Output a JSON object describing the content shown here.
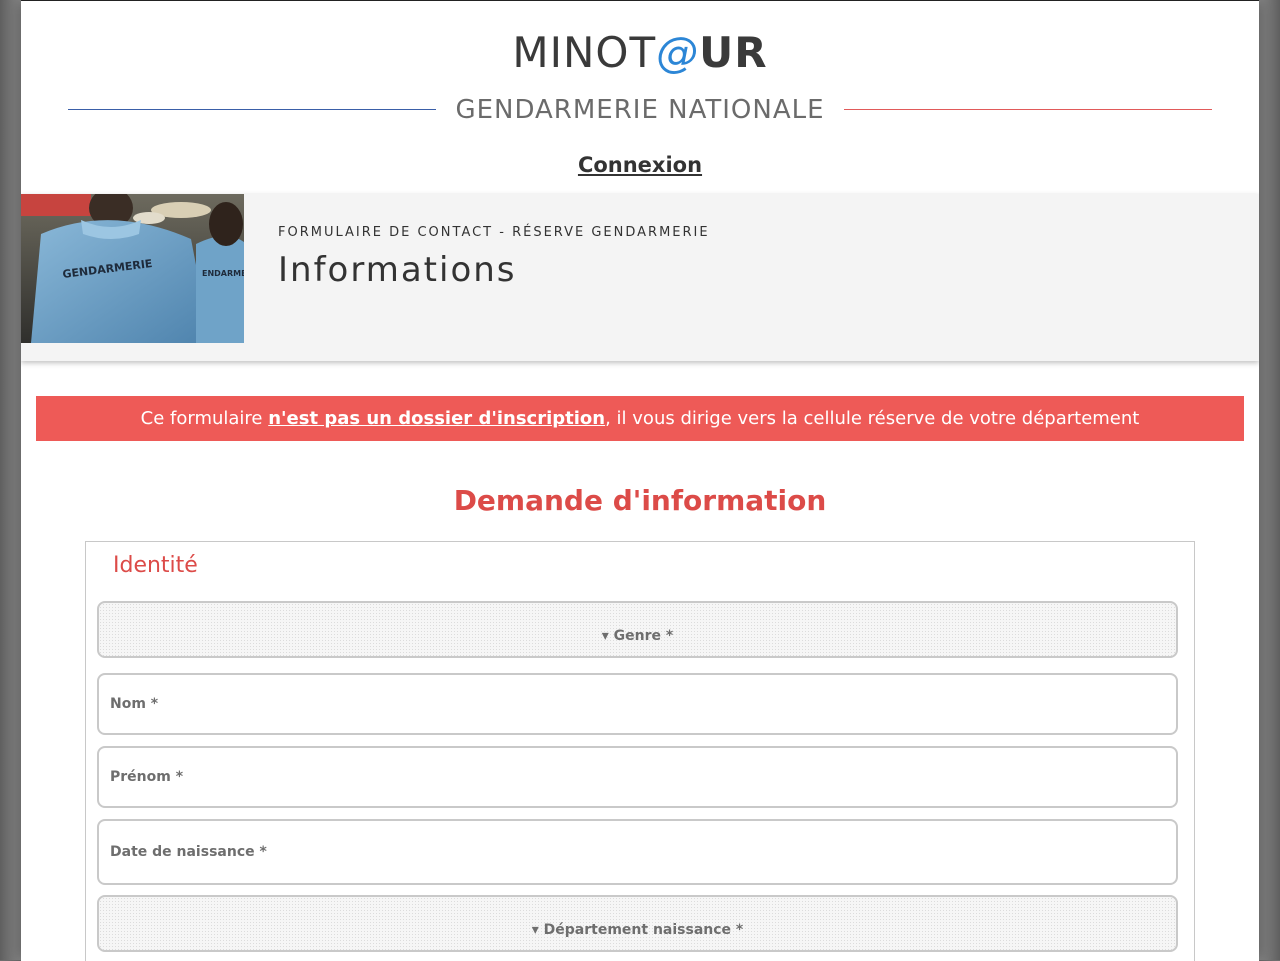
{
  "header": {
    "logo": {
      "part1": "MINOT",
      "at": "@",
      "part2": "UR"
    },
    "subtitle": "GENDARMERIE NATIONALE",
    "login_link": "Connexion",
    "line_left_color": "#3a5fa8",
    "line_right_color": "#e15a5a"
  },
  "hero": {
    "kicker": "FORMULAIRE DE CONTACT - RÉSERVE GENDARMERIE",
    "title": "Informations",
    "photo_shirt_text": "GENDARMERIE",
    "photo_shirt_text_2": "ENDARME"
  },
  "alert": {
    "prefix": "Ce formulaire ",
    "link": "n'est pas un dossier d'inscription",
    "suffix": ", il vous dirige vers la cellule réserve de votre département",
    "color": "#ee5a57"
  },
  "form": {
    "title": "Demande d'information",
    "accent_color": "#dc4b48",
    "fieldset_legend": "Identité",
    "fields": [
      {
        "label": "▾ Genre *",
        "type": "select"
      },
      {
        "label": "Nom *",
        "type": "text"
      },
      {
        "label": "Prénom *",
        "type": "text"
      },
      {
        "label": "Date de naissance *",
        "type": "text"
      },
      {
        "label": "▾ Département naissance *",
        "type": "select"
      }
    ]
  }
}
